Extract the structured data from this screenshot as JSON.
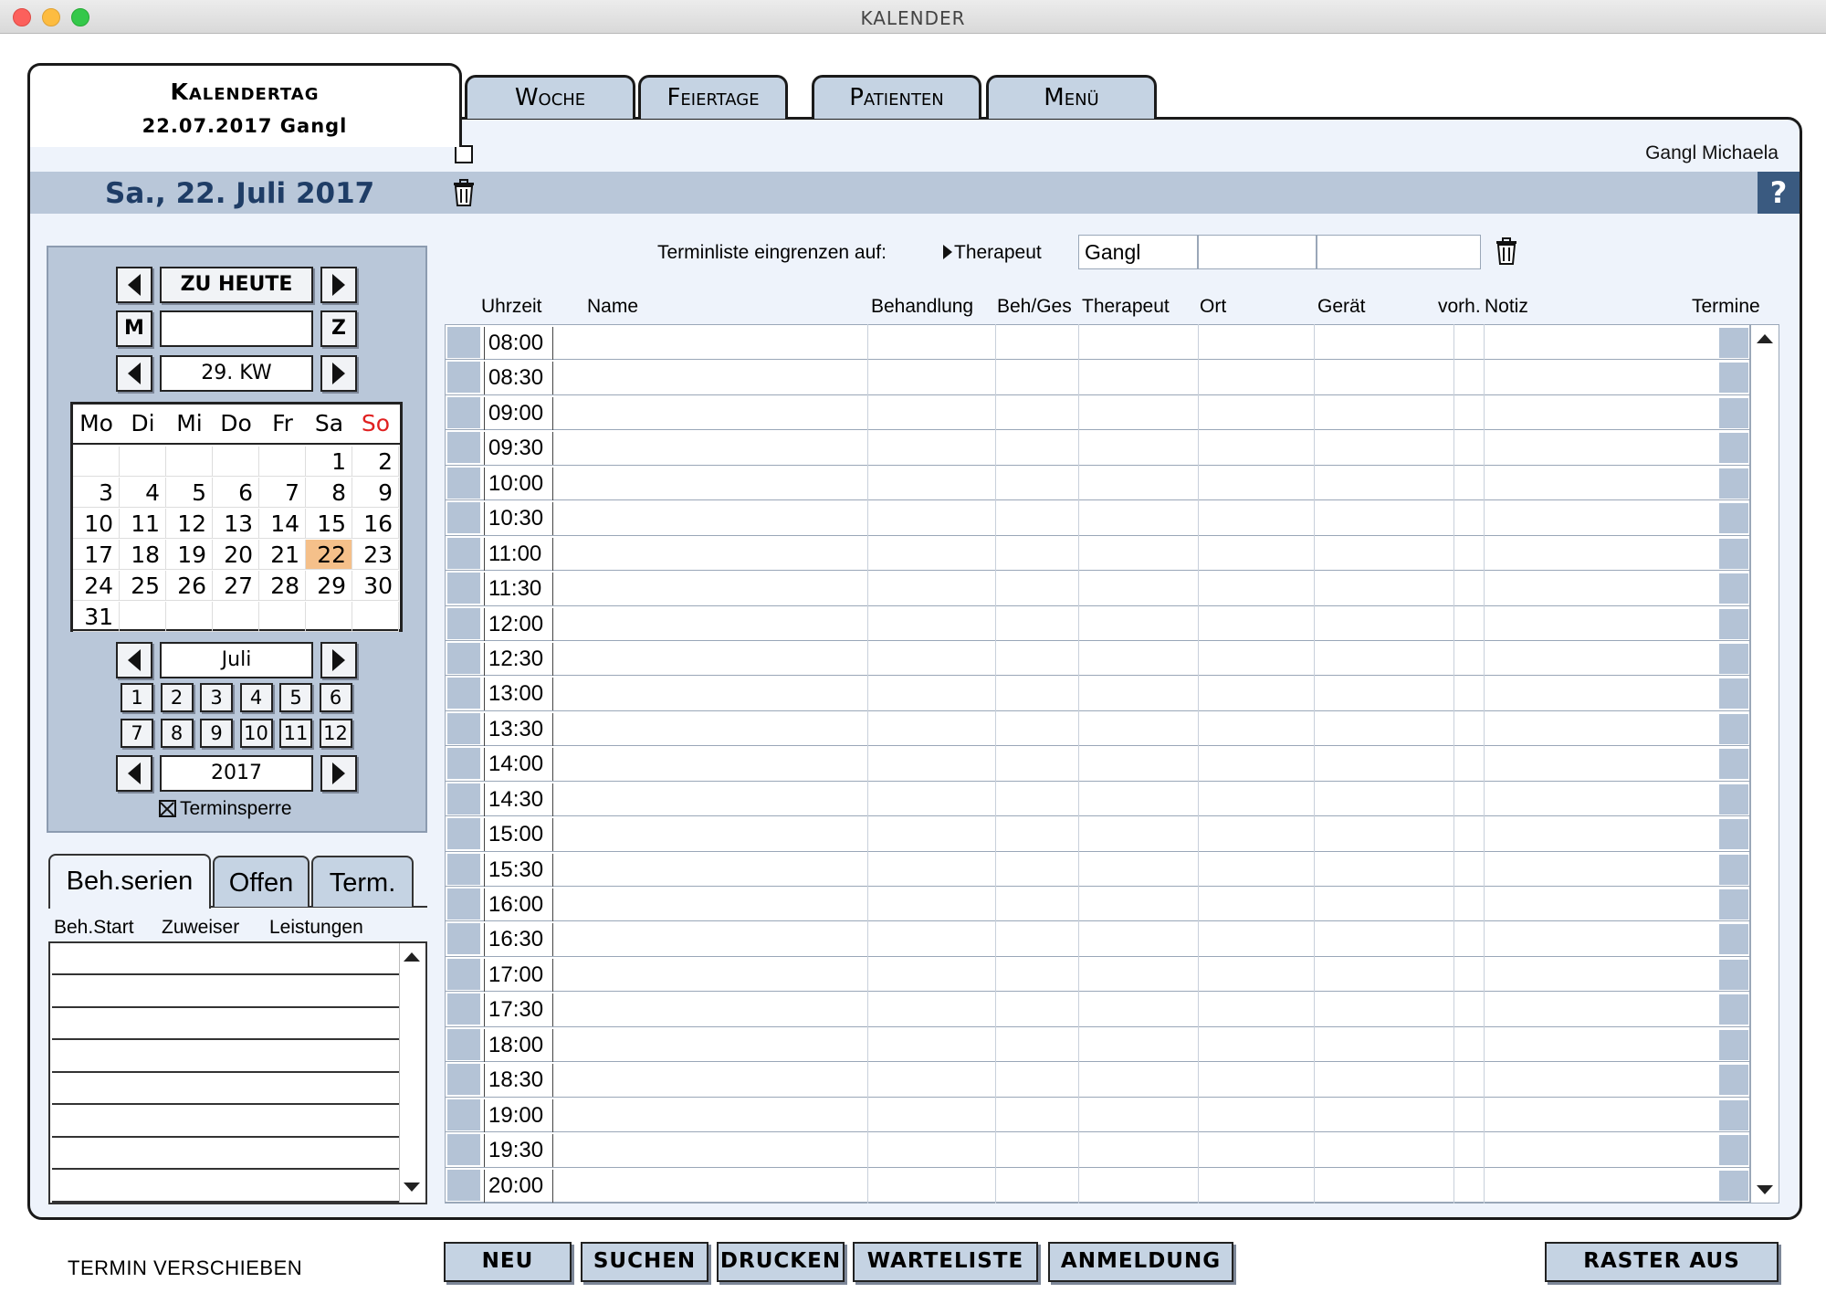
{
  "window": {
    "title": "KALENDER"
  },
  "tabs": {
    "active": {
      "title": "Kalendertag",
      "subtitle": "22.07.2017  Gangl"
    },
    "others": [
      "Woche",
      "Feiertage",
      "Patienten",
      "Menü"
    ]
  },
  "header": {
    "user": "Gangl Michaela",
    "date_heading": "Sa., 22. Juli 2017",
    "help": "?"
  },
  "navigator": {
    "today_label": "ZU HEUTE",
    "m_label": "M",
    "z_label": "Z",
    "m_field": "",
    "week_label": "29. KW",
    "weekdays": [
      "Mo",
      "Di",
      "Mi",
      "Do",
      "Fr",
      "Sa",
      "So"
    ],
    "weeks": [
      [
        "",
        "",
        "",
        "",
        "",
        "1",
        "2"
      ],
      [
        "3",
        "4",
        "5",
        "6",
        "7",
        "8",
        "9"
      ],
      [
        "10",
        "11",
        "12",
        "13",
        "14",
        "15",
        "16"
      ],
      [
        "17",
        "18",
        "19",
        "20",
        "21",
        "22",
        "23"
      ],
      [
        "24",
        "25",
        "26",
        "27",
        "28",
        "29",
        "30"
      ],
      [
        "31",
        "",
        "",
        "",
        "",
        "",
        ""
      ]
    ],
    "selected_day": "22",
    "sunday_color": "#e02020",
    "selected_color": "#f5c08a",
    "month_label": "Juli",
    "months": [
      "1",
      "2",
      "3",
      "4",
      "5",
      "6",
      "7",
      "8",
      "9",
      "10",
      "11",
      "12"
    ],
    "year_label": "2017",
    "terminsperre_label": "Terminsperre",
    "terminsperre_checked": true
  },
  "lower_tabs": {
    "tabs": [
      "Beh.serien",
      "Offen",
      "Term."
    ],
    "columns": [
      "Beh.Start",
      "Zuweiser",
      "Leistungen"
    ]
  },
  "filter": {
    "label": "Terminliste eingrenzen auf:",
    "field_name": "Therapeut",
    "value": "Gangl"
  },
  "schedule": {
    "columns": [
      "Uhrzeit",
      "Name",
      "Behandlung",
      "Beh/Ges",
      "Therapeut",
      "Ort",
      "Gerät",
      "vorh.",
      "Notiz",
      "Termine"
    ],
    "times": [
      "08:00",
      "08:30",
      "09:00",
      "09:30",
      "10:00",
      "10:30",
      "11:00",
      "11:30",
      "12:00",
      "12:30",
      "13:00",
      "13:30",
      "14:00",
      "14:30",
      "15:00",
      "15:30",
      "16:00",
      "16:30",
      "17:00",
      "17:30",
      "18:00",
      "18:30",
      "19:00",
      "19:30",
      "20:00"
    ]
  },
  "footer": {
    "move_label": "TERMIN VERSCHIEBEN",
    "buttons": [
      "NEU",
      "SUCHEN",
      "DRUCKEN",
      "WARTELISTE",
      "ANMELDUNG"
    ],
    "raster_label": "RASTER AUS"
  }
}
